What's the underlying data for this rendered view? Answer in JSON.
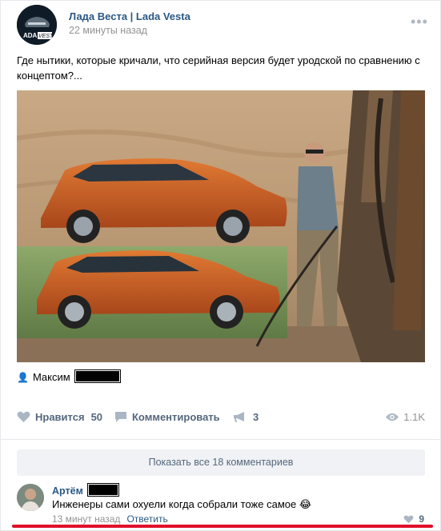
{
  "post": {
    "author": "Лада Веста | Lada Vesta",
    "time": "22 минуты назад",
    "text": "Где нытики, которые кричали, что серийная версия будет уродской по сравнению с концептом?...",
    "photo_credit": "Максим"
  },
  "actions": {
    "like_label": "Нравится",
    "like_count": "50",
    "comment_label": "Комментировать",
    "share_count": "3",
    "views": "1.1K"
  },
  "comments": {
    "show_all": "Показать все 18 комментариев",
    "items": [
      {
        "author": "Артём",
        "text": "Инженеры сами охуели когда собрали тоже самое 😂",
        "time": "13 минут назад",
        "reply_label": "Ответить",
        "likes": "9"
      }
    ]
  },
  "colors": {
    "link": "#2a5885",
    "meta": "#939393",
    "accent_underline": "#e0102b"
  },
  "icons": [
    "more-dots-icon",
    "user-icon",
    "heart-icon",
    "comment-icon",
    "share-megaphone-icon",
    "eye-icon"
  ]
}
